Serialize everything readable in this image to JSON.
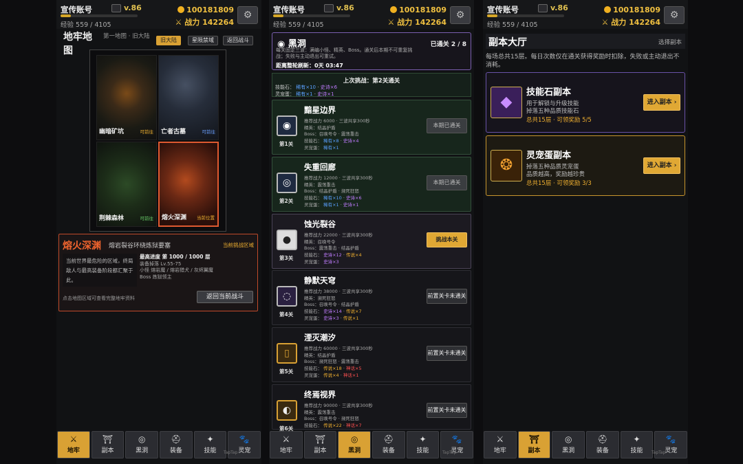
{
  "topbar": {
    "account": "宣传账号",
    "version": "v.86",
    "xp_progress": 0.135,
    "xp": "经验 559 / 4105",
    "gold": "100181809",
    "power": "战力 142264"
  },
  "nav": [
    "地牢",
    "副本",
    "黑洞",
    "装备",
    "技能",
    "灵宠"
  ],
  "watermark": "TapTap",
  "dungeon": {
    "title": "地牢地图",
    "crumb": "第一地图 · 旧大陆",
    "pills": [
      "旧大陆",
      "星陨禁域",
      "返回战斗"
    ],
    "tiles": [
      {
        "name": "幽暗矿坑",
        "status": "可前往"
      },
      {
        "name": "亡者古墓",
        "status": "可前往"
      },
      {
        "name": "荆棘森林",
        "status": "可前往"
      },
      {
        "name": "熔火深渊",
        "status": "当前位置"
      }
    ],
    "info": {
      "name": "熔火深渊",
      "subtitle": "熔岩裂谷环绕炼狱要塞",
      "tag": "当前挑战区域",
      "desc": "当前世界最危险的区域，终局敌人与最高装备阶段都汇聚于此。",
      "progress": "最高进度 第 1000 / 1000 层",
      "drop": "装备掉落 Lv.55-75",
      "minions": "小怪 熔岩魔 / 熔岩猎犬 / 灰烬翼魔",
      "boss": "Boss 炼狱领主",
      "hint": "点击地图区域可查看完整地牢资料",
      "back_button": "返回当前战斗"
    }
  },
  "blackhole": {
    "title": "黑洞",
    "cleared": "已通关 2 / 8",
    "desc": "每关固定三波：满编小怪、精英、Boss。通关后本期不可重复挑战；失败与主动退出可重试。",
    "reset": "距离整轮刷新：0天 03:47",
    "last": {
      "title": "上次挑战：第2关通关",
      "skill_label": "技能石：",
      "skill_rare": "稀有×10",
      "skill_epic": "史诗×6",
      "pet_label": "灵宠蛋：",
      "pet_rare": "稀有×1",
      "pet_epic": "史诗×1"
    },
    "stages": [
      {
        "name": "黯星边界",
        "num": "第1关",
        "icon": "◉",
        "power": "推荐战力 6000 · 三波共享300秒",
        "elite": "精英：结晶护盾",
        "boss": "Boss：召唤号令 · 震荡重击",
        "skill_label": "技能石：",
        "skill_a": "稀有×8",
        "skill_b": "史诗×4",
        "pet_label": "灵宠蛋：",
        "pet_a": "稀有×1",
        "pet_b": "",
        "button": "本期已通关"
      },
      {
        "name": "失重回廊",
        "num": "第2关",
        "icon": "◎",
        "power": "推荐战力 12000 · 三波共享300秒",
        "elite": "精英：震荡重击",
        "boss": "Boss：结晶护盾 · 濒死狂怒",
        "skill_label": "技能石：",
        "skill_a": "稀有×10",
        "skill_b": "史诗×6",
        "pet_label": "灵宠蛋：",
        "pet_a": "稀有×1",
        "pet_b": "史诗×1",
        "button": "本期已通关"
      },
      {
        "name": "蚀光裂谷",
        "num": "第3关",
        "icon": "●",
        "power": "推荐战力 22000 · 三波共享300秒",
        "elite": "精英：召唤号令",
        "boss": "Boss：震荡重击 · 结晶护盾",
        "skill_label": "技能石：",
        "skill_a": "史诗×12",
        "skill_b": "传说×4",
        "pet_label": "灵宠蛋：",
        "pet_a": "史诗×3",
        "pet_b": "",
        "button": "挑战本关"
      },
      {
        "name": "静默天穹",
        "num": "第4关",
        "icon": "◌",
        "power": "推荐战力 38000 · 三波共享300秒",
        "elite": "精英：濒死狂怒",
        "boss": "Boss：召唤号令 · 结晶护盾",
        "skill_label": "技能石：",
        "skill_a": "史诗×14",
        "skill_b": "传说×7",
        "pet_label": "灵宠蛋：",
        "pet_a": "史诗×3",
        "pet_b": "传说×1",
        "button": "前置关卡未通关"
      },
      {
        "name": "湮灭潮汐",
        "num": "第5关",
        "icon": "▯",
        "power": "推荐战力 60000 · 三波共享300秒",
        "elite": "精英：结晶护盾",
        "boss": "Boss：濒死狂怒 · 震荡重击",
        "skill_label": "技能石：",
        "skill_a": "传说×18",
        "skill_b": "神话×5",
        "pet_label": "灵宠蛋：",
        "pet_a": "传说×4",
        "pet_b": "神话×1",
        "button": "前置关卡未通关"
      },
      {
        "name": "终焉视界",
        "num": "第6关",
        "icon": "◐",
        "power": "推荐战力 90000 · 三波共享300秒",
        "elite": "精英：震荡重击",
        "boss": "Boss：召唤号令 · 濒死狂怒",
        "skill_label": "技能石：",
        "skill_a": "传说×22",
        "skill_b": "神话×7",
        "pet_label": "",
        "pet_a": "",
        "pet_b": "",
        "button": "前置关卡未通关"
      }
    ]
  },
  "fuben": {
    "title": "副本大厅",
    "select": "选择副本",
    "desc": "每场总共15层。每日次数仅在通关获得奖励时扣除，失败或主动退出不消耗。",
    "cards": [
      {
        "name": "技能石副本",
        "line1": "用于解锁与升级技能",
        "line2": "掉落五种品质技能石",
        "reward": "总共15层 · 可领奖励 5/5",
        "button": "进入副本 ›"
      },
      {
        "name": "灵宠蛋副本",
        "line1": "掉落五种品质灵宠蛋",
        "line2": "品质越高，奖励越珍贵",
        "reward": "总共15层 · 可领奖励 3/3",
        "button": "进入副本 ›"
      }
    ]
  }
}
